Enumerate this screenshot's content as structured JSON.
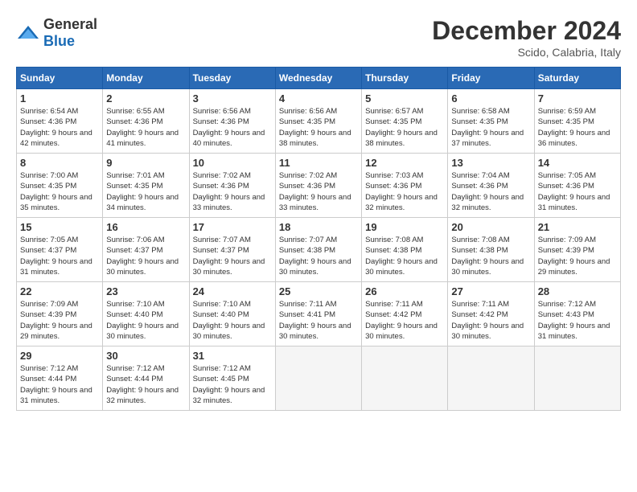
{
  "header": {
    "logo_general": "General",
    "logo_blue": "Blue",
    "title": "December 2024",
    "location": "Scido, Calabria, Italy"
  },
  "days_of_week": [
    "Sunday",
    "Monday",
    "Tuesday",
    "Wednesday",
    "Thursday",
    "Friday",
    "Saturday"
  ],
  "weeks": [
    [
      {
        "num": "1",
        "sunrise": "6:54 AM",
        "sunset": "4:36 PM",
        "daylight": "9 hours and 42 minutes."
      },
      {
        "num": "2",
        "sunrise": "6:55 AM",
        "sunset": "4:36 PM",
        "daylight": "9 hours and 41 minutes."
      },
      {
        "num": "3",
        "sunrise": "6:56 AM",
        "sunset": "4:36 PM",
        "daylight": "9 hours and 40 minutes."
      },
      {
        "num": "4",
        "sunrise": "6:56 AM",
        "sunset": "4:35 PM",
        "daylight": "9 hours and 38 minutes."
      },
      {
        "num": "5",
        "sunrise": "6:57 AM",
        "sunset": "4:35 PM",
        "daylight": "9 hours and 38 minutes."
      },
      {
        "num": "6",
        "sunrise": "6:58 AM",
        "sunset": "4:35 PM",
        "daylight": "9 hours and 37 minutes."
      },
      {
        "num": "7",
        "sunrise": "6:59 AM",
        "sunset": "4:35 PM",
        "daylight": "9 hours and 36 minutes."
      }
    ],
    [
      {
        "num": "8",
        "sunrise": "7:00 AM",
        "sunset": "4:35 PM",
        "daylight": "9 hours and 35 minutes."
      },
      {
        "num": "9",
        "sunrise": "7:01 AM",
        "sunset": "4:35 PM",
        "daylight": "9 hours and 34 minutes."
      },
      {
        "num": "10",
        "sunrise": "7:02 AM",
        "sunset": "4:36 PM",
        "daylight": "9 hours and 33 minutes."
      },
      {
        "num": "11",
        "sunrise": "7:02 AM",
        "sunset": "4:36 PM",
        "daylight": "9 hours and 33 minutes."
      },
      {
        "num": "12",
        "sunrise": "7:03 AM",
        "sunset": "4:36 PM",
        "daylight": "9 hours and 32 minutes."
      },
      {
        "num": "13",
        "sunrise": "7:04 AM",
        "sunset": "4:36 PM",
        "daylight": "9 hours and 32 minutes."
      },
      {
        "num": "14",
        "sunrise": "7:05 AM",
        "sunset": "4:36 PM",
        "daylight": "9 hours and 31 minutes."
      }
    ],
    [
      {
        "num": "15",
        "sunrise": "7:05 AM",
        "sunset": "4:37 PM",
        "daylight": "9 hours and 31 minutes."
      },
      {
        "num": "16",
        "sunrise": "7:06 AM",
        "sunset": "4:37 PM",
        "daylight": "9 hours and 30 minutes."
      },
      {
        "num": "17",
        "sunrise": "7:07 AM",
        "sunset": "4:37 PM",
        "daylight": "9 hours and 30 minutes."
      },
      {
        "num": "18",
        "sunrise": "7:07 AM",
        "sunset": "4:38 PM",
        "daylight": "9 hours and 30 minutes."
      },
      {
        "num": "19",
        "sunrise": "7:08 AM",
        "sunset": "4:38 PM",
        "daylight": "9 hours and 30 minutes."
      },
      {
        "num": "20",
        "sunrise": "7:08 AM",
        "sunset": "4:38 PM",
        "daylight": "9 hours and 30 minutes."
      },
      {
        "num": "21",
        "sunrise": "7:09 AM",
        "sunset": "4:39 PM",
        "daylight": "9 hours and 29 minutes."
      }
    ],
    [
      {
        "num": "22",
        "sunrise": "7:09 AM",
        "sunset": "4:39 PM",
        "daylight": "9 hours and 29 minutes."
      },
      {
        "num": "23",
        "sunrise": "7:10 AM",
        "sunset": "4:40 PM",
        "daylight": "9 hours and 30 minutes."
      },
      {
        "num": "24",
        "sunrise": "7:10 AM",
        "sunset": "4:40 PM",
        "daylight": "9 hours and 30 minutes."
      },
      {
        "num": "25",
        "sunrise": "7:11 AM",
        "sunset": "4:41 PM",
        "daylight": "9 hours and 30 minutes."
      },
      {
        "num": "26",
        "sunrise": "7:11 AM",
        "sunset": "4:42 PM",
        "daylight": "9 hours and 30 minutes."
      },
      {
        "num": "27",
        "sunrise": "7:11 AM",
        "sunset": "4:42 PM",
        "daylight": "9 hours and 30 minutes."
      },
      {
        "num": "28",
        "sunrise": "7:12 AM",
        "sunset": "4:43 PM",
        "daylight": "9 hours and 31 minutes."
      }
    ],
    [
      {
        "num": "29",
        "sunrise": "7:12 AM",
        "sunset": "4:44 PM",
        "daylight": "9 hours and 31 minutes."
      },
      {
        "num": "30",
        "sunrise": "7:12 AM",
        "sunset": "4:44 PM",
        "daylight": "9 hours and 32 minutes."
      },
      {
        "num": "31",
        "sunrise": "7:12 AM",
        "sunset": "4:45 PM",
        "daylight": "9 hours and 32 minutes."
      },
      null,
      null,
      null,
      null
    ]
  ]
}
